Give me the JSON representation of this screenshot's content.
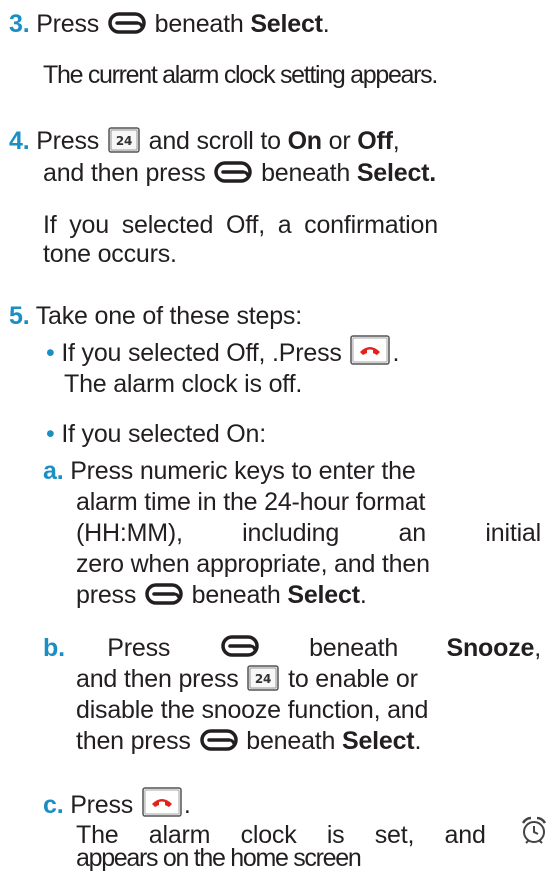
{
  "steps": {
    "s3": {
      "num": "3.",
      "press": "Press",
      "beneath": "beneath",
      "select": "Select",
      "period": ".",
      "result": "The current alarm clock setting appears."
    },
    "s4": {
      "num": "4.",
      "press": "Press",
      "scroll": "and scroll to",
      "on": "On",
      "or": "or",
      "off": "Off",
      "comma": ",",
      "then_press": "and then press",
      "beneath": "beneath",
      "select": "Select.",
      "confirm1": "If you selected Off, a confirmation",
      "confirm2": "tone occurs."
    },
    "s5": {
      "num": "5.",
      "intro": "Take one of these steps:",
      "bullet_off_text": "If you selected Off, .Press",
      "bullet_off_period": ".",
      "bullet_off_result": "The alarm clock is off.",
      "bullet_on_text": "If you selected On:",
      "a": {
        "label": "a.",
        "line1": "Press numeric keys to enter the",
        "line2": "alarm time in the 24-hour format",
        "line3_w1": "(HH:MM),",
        "line3_w2": "including",
        "line3_w3": "an",
        "line3_w4": "initial",
        "line4": "zero when appropriate, and then",
        "press": "press",
        "beneath": "beneath",
        "select": "Select",
        "period": "."
      },
      "b": {
        "label": "b.",
        "press": "Press",
        "beneath": "beneath",
        "snooze": "Snooze",
        "comma": ",",
        "then_press": "and then press",
        "enable": "to enable or",
        "line3": "disable the snooze function, and",
        "then_press2": "then press",
        "beneath2": "beneath",
        "select": "Select",
        "period": "."
      },
      "c": {
        "label": "c.",
        "press": "Press",
        "period": ".",
        "result1_w1": "The",
        "result1_w2": "alarm",
        "result1_w3": "clock",
        "result1_w4": "is",
        "result1_w5": "set,",
        "result1_w6": "and",
        "result2": "appears on the home screen"
      }
    }
  },
  "icons": {
    "soft_key": "soft-key-icon",
    "nav_key": "navigation-key-icon",
    "end_key": "end-key-icon",
    "alarm": "alarm-clock-icon"
  },
  "colors": {
    "step_number": "#1a8fc4",
    "text": "#231f20",
    "end_key_red": "#e2231a"
  }
}
